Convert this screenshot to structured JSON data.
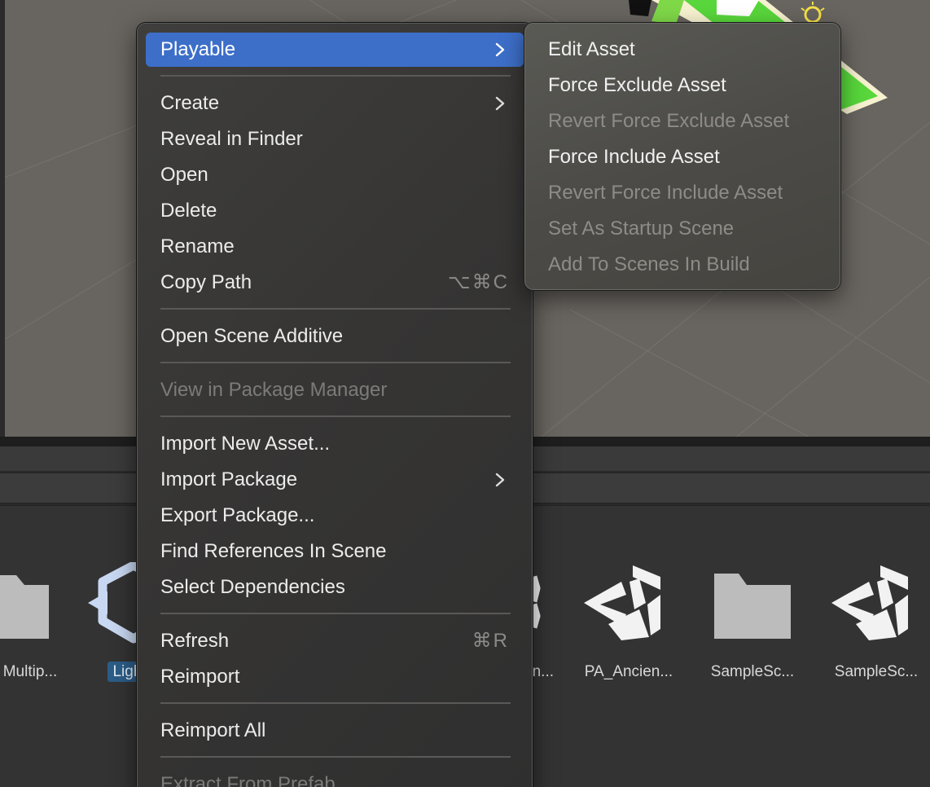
{
  "context_menu": {
    "items": [
      {
        "label": "Playable",
        "enabled": true,
        "highlighted": true,
        "submenu": true
      },
      {
        "label": "Create",
        "enabled": true,
        "submenu": true
      },
      {
        "label": "Reveal in Finder",
        "enabled": true
      },
      {
        "label": "Open",
        "enabled": true
      },
      {
        "label": "Delete",
        "enabled": true
      },
      {
        "label": "Rename",
        "enabled": true
      },
      {
        "label": "Copy Path",
        "enabled": true,
        "shortcut": "⌥⌘C"
      },
      {
        "label": "Open Scene Additive",
        "enabled": true
      },
      {
        "label": "View in Package Manager",
        "enabled": false
      },
      {
        "label": "Import New Asset...",
        "enabled": true
      },
      {
        "label": "Import Package",
        "enabled": true,
        "submenu": true
      },
      {
        "label": "Export Package...",
        "enabled": true
      },
      {
        "label": "Find References In Scene",
        "enabled": true
      },
      {
        "label": "Select Dependencies",
        "enabled": true
      },
      {
        "label": "Refresh",
        "enabled": true,
        "shortcut": "⌘R"
      },
      {
        "label": "Reimport",
        "enabled": true
      },
      {
        "label": "Reimport All",
        "enabled": true
      },
      {
        "label": "Extract From Prefab",
        "enabled": false
      }
    ]
  },
  "submenu": {
    "items": [
      {
        "label": "Edit Asset",
        "enabled": true
      },
      {
        "label": "Force Exclude Asset",
        "enabled": true
      },
      {
        "label": "Revert Force Exclude Asset",
        "enabled": false
      },
      {
        "label": "Force Include Asset",
        "enabled": true
      },
      {
        "label": "Revert Force Include Asset",
        "enabled": false
      },
      {
        "label": "Set As Startup Scene",
        "enabled": false
      },
      {
        "label": "Add To Scenes In Build",
        "enabled": false
      }
    ]
  },
  "project_assets": [
    {
      "name": "Multip...",
      "icon": "folder-icon"
    },
    {
      "name": "LightM",
      "icon": "unity-scene-icon",
      "selected": true
    },
    {
      "name": "n...",
      "icon": "unity-scene-icon"
    },
    {
      "name": "PA_Ancien...",
      "icon": "unity-scene-icon"
    },
    {
      "name": "SampleSc...",
      "icon": "folder-icon"
    },
    {
      "name": "SampleSc...",
      "icon": "unity-scene-icon"
    }
  ],
  "colors": {
    "highlight": "#3d6fc9",
    "menu_bg": "#393837",
    "submenu_bg": "#4f4e4a",
    "disabled_text": "#7b7b79",
    "selection": "#2c5d87"
  }
}
